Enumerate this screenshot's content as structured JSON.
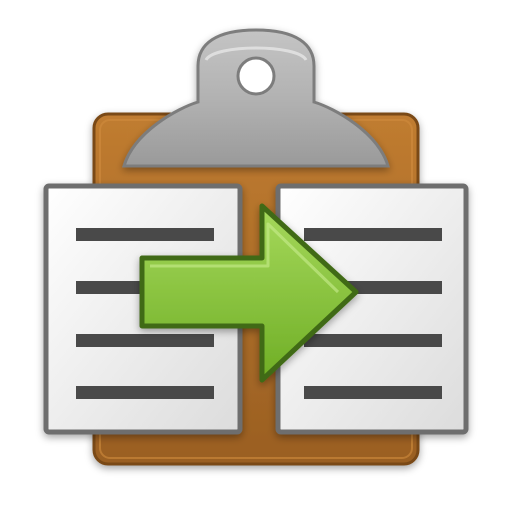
{
  "icon": {
    "name": "clipboard-copy-icon",
    "colors": {
      "background": "#ffffff",
      "clipboard_board": "#b0702a",
      "clipboard_board_dark": "#7a4a17",
      "clip_metal_light": "#d6d6d6",
      "clip_metal_dark": "#8f8f8f",
      "page_fill": "#f4f4f4",
      "page_border": "#6e6e6e",
      "text_line": "#4a4a4a",
      "arrow_fill": "#8cc63f",
      "arrow_stroke": "#3f6b12"
    }
  }
}
